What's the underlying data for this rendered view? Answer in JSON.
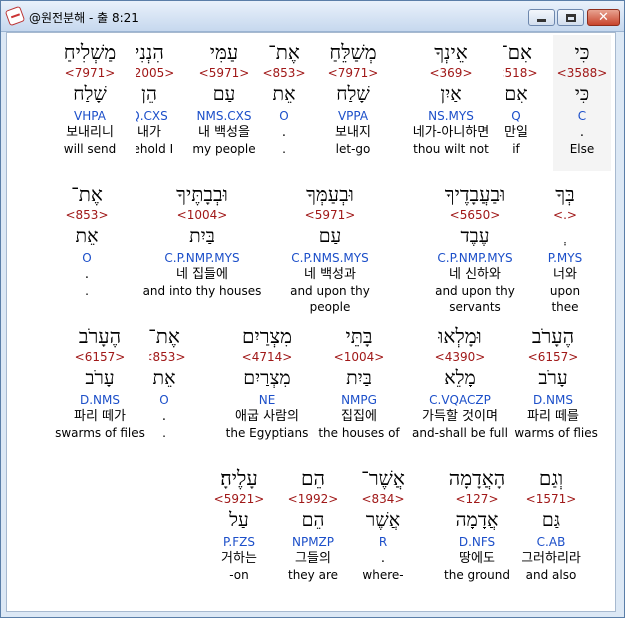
{
  "window": {
    "title": "@원전분해 - 출 8:21",
    "minimize_icon": "minimize-icon",
    "maximize_icon": "maximize-icon",
    "close_icon": "close-icon"
  },
  "rows": [
    [
      {
        "hebrew": "כִּי",
        "strong": "<3588>",
        "root": "כִּי",
        "parse": "C",
        "korean": ".",
        "english": "Else",
        "selected": true
      },
      {
        "hebrew": "אִם־",
        "strong": "<518>",
        "root": "אִם",
        "parse": "Q",
        "korean": "만일",
        "english": "if"
      },
      {
        "hebrew": "אֵינְךָ",
        "strong": "<369>",
        "root": "אַיִן",
        "parse": "NS.MYS",
        "korean": "네가-아니하면",
        "english": "thou wilt not"
      },
      {
        "hebrew": "מְשַׁלֵּחַ",
        "strong": "<7971>",
        "root": "שָׁלַח",
        "parse": "VPPA",
        "korean": "보내지",
        "english": "let-go"
      },
      {
        "hebrew": "אֶת־",
        "strong": "<853>",
        "root": "אֵת",
        "parse": "O",
        "korean": ".",
        "english": "."
      },
      {
        "hebrew": "עַמִּי",
        "strong": "<5971>",
        "root": "עַם",
        "parse": "NMS.CXS",
        "korean": "내 백성을",
        "english": "my people"
      },
      {
        "hebrew": "הִנְנִי",
        "strong": "<2005>",
        "root": "הֵן",
        "parse": "Q.CXS",
        "korean": "내가",
        "english": "behold I"
      },
      {
        "hebrew": "מַשְׁלִיחַ",
        "strong": "<7971>",
        "root": "שָׁלַח",
        "parse": "VHPA",
        "korean": "보내리니",
        "english": "will send"
      }
    ],
    [
      {
        "hebrew": "בְּךָ",
        "strong": "<.>",
        "root": "ְ",
        "parse": "P.MYS",
        "korean": "너와",
        "english": "upon thee"
      },
      {
        "hebrew": "וּבַעֲבָדֶיךָ",
        "strong": "<5650>",
        "root": "עֶבֶד",
        "parse": "C.P.NMP.MYS",
        "korean": "네 신하와",
        "english": "and upon thy servants"
      },
      {
        "hebrew": "וּבְעַמְּךָ",
        "strong": "<5971>",
        "root": "עַם",
        "parse": "C.P.NMS.MYS",
        "korean": "네 백성과",
        "english": "and upon thy people"
      },
      {
        "hebrew": "וּבְבָתֶּיךָ",
        "strong": "<1004>",
        "root": "בַּיִת",
        "parse": "C.P.NMP.MYS",
        "korean": "네 집들에",
        "english": "and into thy houses"
      },
      {
        "hebrew": "אֶת־",
        "strong": "<853>",
        "root": "אֵת",
        "parse": "O",
        "korean": ".",
        "english": "."
      }
    ],
    [
      {
        "hebrew": "הֶעָרֹב",
        "strong": "<6157>",
        "root": "עָרֹב",
        "parse": "D.NMS",
        "korean": "파리 떼를",
        "english": "swarms of flies"
      },
      {
        "hebrew": "וּמָלְאוּ",
        "strong": "<4390>",
        "root": "מָלֵא",
        "parse": "C.VQACZP",
        "korean": "가득할 것이며",
        "english": "and-shall be full"
      },
      {
        "hebrew": "בָּתֵּי",
        "strong": "<1004>",
        "root": "בַּיִת",
        "parse": "NMPG",
        "korean": "집집에",
        "english": "the houses of"
      },
      {
        "hebrew": "מִצְרַיִם",
        "strong": "<4714>",
        "root": "מִצְרַיִם",
        "parse": "NE",
        "korean": "애굽 사람의",
        "english": "the Egyptians"
      },
      {
        "hebrew": "אֶת־",
        "strong": "<853>",
        "root": "אֵת",
        "parse": "O",
        "korean": ".",
        "english": "."
      },
      {
        "hebrew": "הֶעָרֹב",
        "strong": "<6157>",
        "root": "עָרֹב",
        "parse": "D.NMS",
        "korean": "파리 떼가",
        "english": "swarms of files"
      }
    ],
    [
      {
        "hebrew": "וְגַם",
        "strong": "<1571>",
        "root": "גַּם",
        "parse": "C.AB",
        "korean": "그러하리라",
        "english": "and also"
      },
      {
        "hebrew": "הָאֲדָמָה",
        "strong": "<127>",
        "root": "אֲדָמָה",
        "parse": "D.NFS",
        "korean": "땅에도",
        "english": "the ground"
      },
      {
        "hebrew": "אֲשֶׁר־",
        "strong": "<834>",
        "root": "אֲשֶׁר",
        "parse": "R",
        "korean": ".",
        "english": "where-"
      },
      {
        "hebrew": "הֵם",
        "strong": "<1992>",
        "root": "הֵם",
        "parse": "NPMZP",
        "korean": "그들의",
        "english": "they are"
      },
      {
        "hebrew": "עָלֶיהָ׃",
        "strong": "<5921>",
        "root": "עַל",
        "parse": "P.FZS",
        "korean": "거하는",
        "english": "-on"
      }
    ]
  ]
}
